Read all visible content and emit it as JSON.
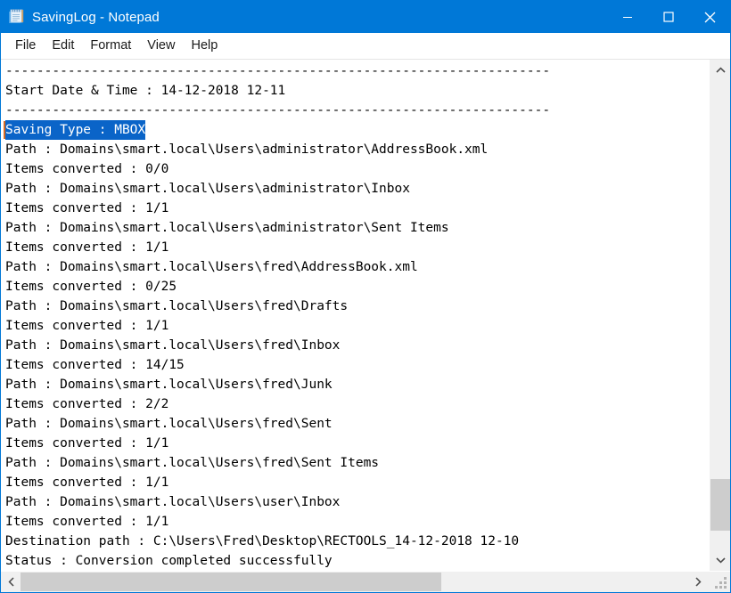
{
  "window": {
    "title": "SavingLog - Notepad",
    "app_icon": "notepad-icon",
    "accent_color": "#0078d7",
    "controls": {
      "minimize": "minimize-icon",
      "maximize": "maximize-icon",
      "close": "close-icon"
    }
  },
  "menubar": {
    "items": [
      {
        "label": "File"
      },
      {
        "label": "Edit"
      },
      {
        "label": "Format"
      },
      {
        "label": "View"
      },
      {
        "label": "Help"
      }
    ]
  },
  "document": {
    "selection": {
      "text": "Saving Type : MBOX",
      "line_index": 3,
      "highlight_color": "#0a64c8",
      "text_color": "#ffffff",
      "caret_color": "#d86b22"
    },
    "lines": [
      {
        "text": "----------------------------------------------------------------------",
        "selected": false
      },
      {
        "text": "Start Date & Time : 14-12-2018 12-11",
        "selected": false
      },
      {
        "text": "----------------------------------------------------------------------",
        "selected": false
      },
      {
        "text": "Saving Type : MBOX",
        "selected": true
      },
      {
        "text": "Path : Domains\\smart.local\\Users\\administrator\\AddressBook.xml",
        "selected": false
      },
      {
        "text": "Items converted : 0/0",
        "selected": false
      },
      {
        "text": "Path : Domains\\smart.local\\Users\\administrator\\Inbox",
        "selected": false
      },
      {
        "text": "Items converted : 1/1",
        "selected": false
      },
      {
        "text": "Path : Domains\\smart.local\\Users\\administrator\\Sent Items",
        "selected": false
      },
      {
        "text": "Items converted : 1/1",
        "selected": false
      },
      {
        "text": "Path : Domains\\smart.local\\Users\\fred\\AddressBook.xml",
        "selected": false
      },
      {
        "text": "Items converted : 0/25",
        "selected": false
      },
      {
        "text": "Path : Domains\\smart.local\\Users\\fred\\Drafts",
        "selected": false
      },
      {
        "text": "Items converted : 1/1",
        "selected": false
      },
      {
        "text": "Path : Domains\\smart.local\\Users\\fred\\Inbox",
        "selected": false
      },
      {
        "text": "Items converted : 14/15",
        "selected": false
      },
      {
        "text": "Path : Domains\\smart.local\\Users\\fred\\Junk",
        "selected": false
      },
      {
        "text": "Items converted : 2/2",
        "selected": false
      },
      {
        "text": "Path : Domains\\smart.local\\Users\\fred\\Sent",
        "selected": false
      },
      {
        "text": "Items converted : 1/1",
        "selected": false
      },
      {
        "text": "Path : Domains\\smart.local\\Users\\fred\\Sent Items",
        "selected": false
      },
      {
        "text": "Items converted : 1/1",
        "selected": false
      },
      {
        "text": "Path : Domains\\smart.local\\Users\\user\\Inbox",
        "selected": false
      },
      {
        "text": "Items converted : 1/1",
        "selected": false
      },
      {
        "text": "Destination path : C:\\Users\\Fred\\Desktop\\RECTOOLS_14-12-2018 12-10",
        "selected": false
      },
      {
        "text": "Status : Conversion completed successfully",
        "selected": false
      }
    ]
  },
  "scrollbars": {
    "vertical": {
      "up_arrow": "chevron-up-icon",
      "down_arrow": "chevron-down-icon",
      "thumb_top_pct": 85,
      "thumb_height_pct": 11,
      "track_color": "#f0f0f0",
      "thumb_color": "#cdcdcd"
    },
    "horizontal": {
      "left_arrow": "chevron-left-icon",
      "right_arrow": "chevron-right-icon",
      "thumb_left_pct": 3,
      "thumb_width_pct": 57,
      "track_color": "#f0f0f0",
      "thumb_color": "#cdcdcd"
    },
    "resize_grip": "resize-grip-icon"
  }
}
